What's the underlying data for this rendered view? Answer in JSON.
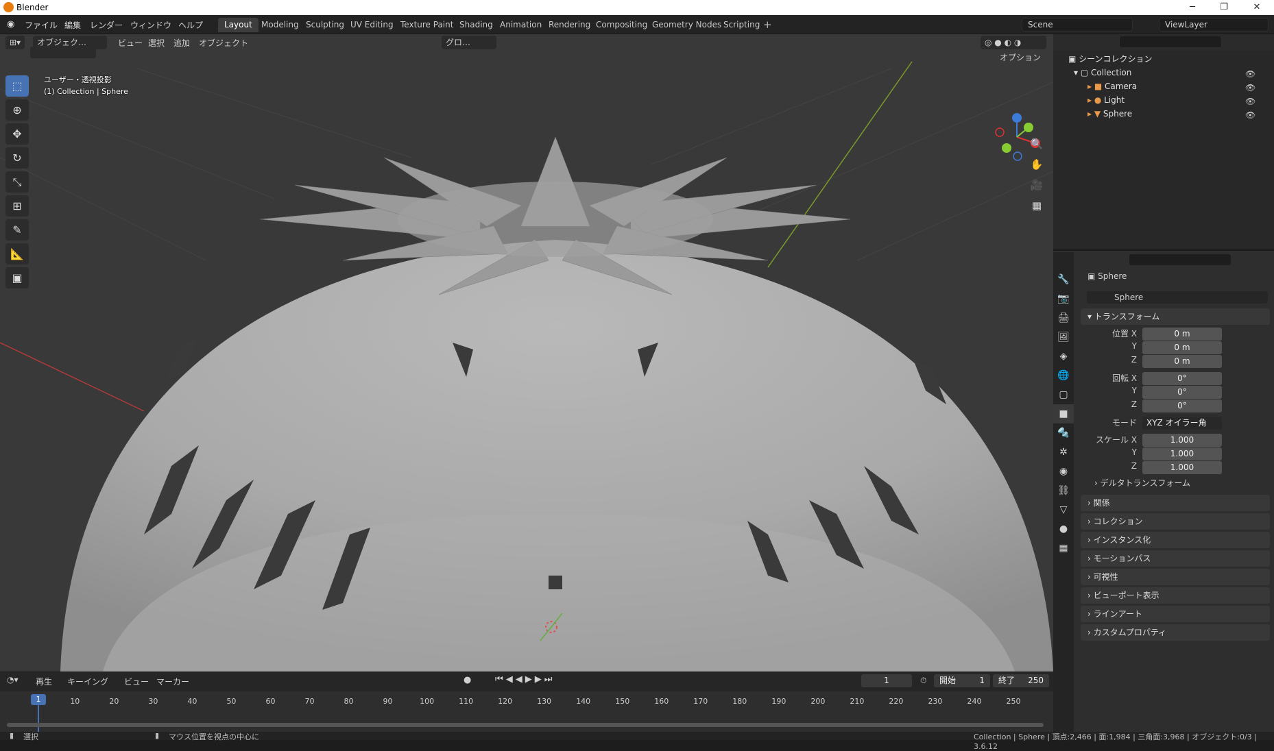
{
  "window": {
    "title": "Blender"
  },
  "menu": [
    "ファイル",
    "編集",
    "レンダー",
    "ウィンドウ",
    "ヘルプ"
  ],
  "workspaces": [
    "Layout",
    "Modeling",
    "Sculpting",
    "UV Editing",
    "Texture Paint",
    "Shading",
    "Animation",
    "Rendering",
    "Compositing",
    "Geometry Nodes",
    "Scripting"
  ],
  "active_workspace": "Layout",
  "scene": {
    "name": "Scene",
    "view_layer": "ViewLayer"
  },
  "viewport_header": {
    "mode": "オブジェク…",
    "menus": [
      "ビュー",
      "選択",
      "追加",
      "オブジェクト"
    ],
    "orientation": "グロ…",
    "options": "オプション"
  },
  "viewport_overlay": {
    "line1": "ユーザー・透視投影",
    "line2": "(1) Collection | Sphere"
  },
  "outliner": {
    "root": "シーンコレクション",
    "collection": "Collection",
    "items": [
      "Camera",
      "Light",
      "Sphere"
    ]
  },
  "properties": {
    "object_name": "Sphere",
    "datablock": "Sphere",
    "transform_header": "トランスフォーム",
    "location_label": "位置 X",
    "rotation_label": "回転 X",
    "scale_label": "スケール X",
    "axis_y": "Y",
    "axis_z": "Z",
    "location": [
      "0 m",
      "0 m",
      "0 m"
    ],
    "rotation": [
      "0°",
      "0°",
      "0°"
    ],
    "mode_label": "モード",
    "mode_value": "XYZ オイラー角",
    "scale": [
      "1.000",
      "1.000",
      "1.000"
    ],
    "delta": "デルタトランスフォーム",
    "panels": [
      "関係",
      "コレクション",
      "インスタンス化",
      "モーションパス",
      "可視性",
      "ビューポート表示",
      "ラインアート",
      "カスタムプロパティ"
    ]
  },
  "timeline": {
    "menus": [
      "再生",
      "キーイング",
      "ビュー",
      "マーカー"
    ],
    "current_frame": "1",
    "start_label": "開始",
    "start": "1",
    "end_label": "終了",
    "end": "250",
    "ticks": [
      "1",
      "10",
      "20",
      "30",
      "40",
      "50",
      "60",
      "70",
      "80",
      "90",
      "100",
      "110",
      "120",
      "130",
      "140",
      "150",
      "160",
      "170",
      "180",
      "190",
      "200",
      "210",
      "220",
      "230",
      "240",
      "250"
    ]
  },
  "statusbar": {
    "left": "選択",
    "middle": "マウス位置を視点の中心に",
    "right": "Collection | Sphere | 頂点:2,466 | 面:1,984 | 三角面:3,968 | オブジェクト:0/3 | 3.6.12"
  }
}
